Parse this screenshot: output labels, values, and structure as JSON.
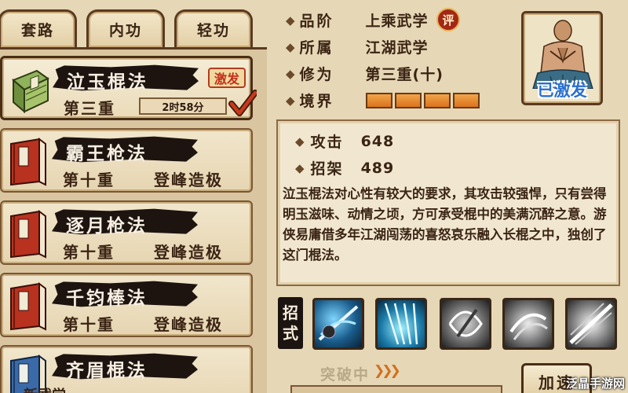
{
  "tabs": [
    {
      "label": "套路"
    },
    {
      "label": "内功"
    },
    {
      "label": "轻功"
    }
  ],
  "skills": [
    {
      "name": "泣玉棍法",
      "level": "第三重",
      "timer": "2时58分",
      "badge": "激发",
      "book_color": "green"
    },
    {
      "name": "霸王枪法",
      "level": "第十重",
      "status": "登峰造极",
      "book_color": "red"
    },
    {
      "name": "逐月枪法",
      "level": "第十重",
      "status": "登峰造极",
      "book_color": "red"
    },
    {
      "name": "千钧棒法",
      "level": "第十重",
      "status": "登峰造极",
      "book_color": "red"
    },
    {
      "name": "齐眉棍法",
      "level": "",
      "status": "",
      "book_color": "blue"
    }
  ],
  "new_skill_label": "新武学",
  "info": {
    "grade_label": "品阶",
    "grade_value": "上乘武学",
    "grade_badge": "评",
    "belong_label": "所属",
    "belong_value": "江湖武学",
    "cultivation_label": "修为",
    "cultivation_value": "第三重(十)",
    "realm_label": "境界",
    "realm_segments": 4
  },
  "portrait": {
    "label": "已激发"
  },
  "detail": {
    "attack_label": "攻击",
    "attack_value": "648",
    "parry_label": "招架",
    "parry_value": "489",
    "description": "泣玉棍法对心性有较大的要求，其攻击较强悍，只有尝得明玉滋味、动情之顷，方可承受棍中的美满沉醉之意。游侠易庸借多年江湖闯荡的喜怒哀乐融入长棍之中，独创了这门棍法。"
  },
  "moves": {
    "label_top": "招",
    "label_bottom": "式"
  },
  "bottom": {
    "breakthrough": "突破中",
    "speed_button": "加速",
    "watermark": "泛晶手游网"
  },
  "colors": {
    "background": "#e6d7b6",
    "accent_red": "#c2301a",
    "border_brown": "#5a3a20",
    "banner_black": "#1d1410",
    "realm_orange": "#e88a2c",
    "activated_blue": "#2a6fd0"
  },
  "icons": {
    "selected_check": "check-icon",
    "diamond_bullet": "diamond-icon"
  }
}
